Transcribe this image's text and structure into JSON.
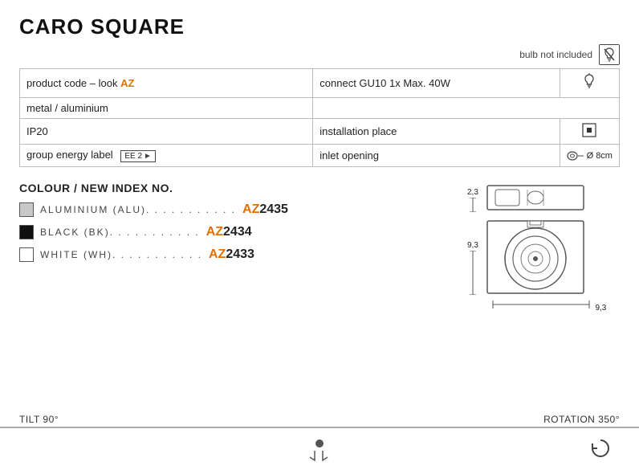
{
  "title": "CARO SQUARE",
  "bulb_not_included": "bulb not included",
  "specs": {
    "product_code_label": "product code – look",
    "product_code_value": "AZ",
    "material": "metal / aluminium",
    "ip": "IP20",
    "group_energy": "group energy label",
    "energy_badge": "EE 2",
    "connect": "connect GU10 1x Max. 40W",
    "installation_place": "installation place",
    "inlet_opening": "inlet opening",
    "inlet_diameter": "Ø 8cm"
  },
  "colour_section_title": "COLOUR / NEW INDEX NO.",
  "colours": [
    {
      "name": "ALUMINIUM (ALU)",
      "swatch": "aluminium",
      "code": "AZ",
      "number": "2435"
    },
    {
      "name": "BLACK (BK)",
      "swatch": "black",
      "code": "AZ",
      "number": "2434"
    },
    {
      "name": "WHITE (WH)",
      "swatch": "white",
      "code": "AZ",
      "number": "2433"
    }
  ],
  "dimensions": {
    "width_top": "2,3",
    "height_side": "9,3",
    "bottom_label": "9,3"
  },
  "bottom": {
    "tilt_label": "TILT 90°",
    "rotation_label": "ROTATION 350°"
  }
}
